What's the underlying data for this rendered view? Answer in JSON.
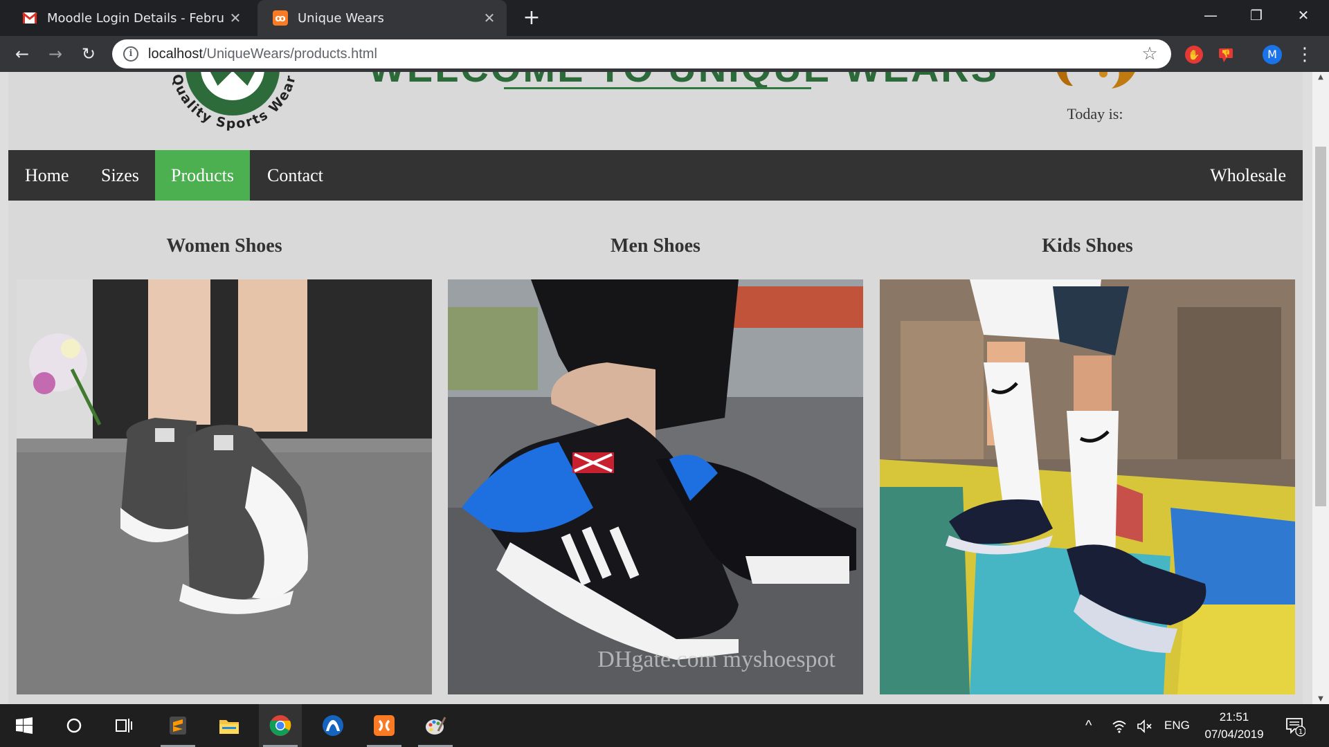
{
  "browser": {
    "tabs": [
      {
        "title": "Moodle Login Details - February",
        "icon": "gmail-icon"
      },
      {
        "title": "Unique Wears",
        "icon": "xampp-icon"
      }
    ],
    "url_host": "localhost",
    "url_path": "/UniqueWears/products.html",
    "avatar_initial": "M"
  },
  "site": {
    "logo_text": "Quality Sports Wear",
    "welcome": "WELCOME TO UNIQUE WEARS",
    "today_label": "Today is:",
    "nav": {
      "items": [
        "Home",
        "Sizes",
        "Products",
        "Contact"
      ],
      "active": "Products",
      "right": "Wholesale"
    },
    "sections": [
      {
        "title": "Women Shoes",
        "image": "women-shoes-photo"
      },
      {
        "title": "Men Shoes",
        "image": "men-shoes-photo",
        "watermark": "DHgate.com  myshoespot"
      },
      {
        "title": "Kids Shoes",
        "image": "kids-shoes-photo"
      }
    ],
    "colors": {
      "nav_bg": "#333333",
      "nav_active": "#4caf50",
      "brand_green": "#2d6a3a"
    }
  },
  "taskbar": {
    "lang": "ENG",
    "time": "21:51",
    "date": "07/04/2019",
    "notifications": "1"
  }
}
